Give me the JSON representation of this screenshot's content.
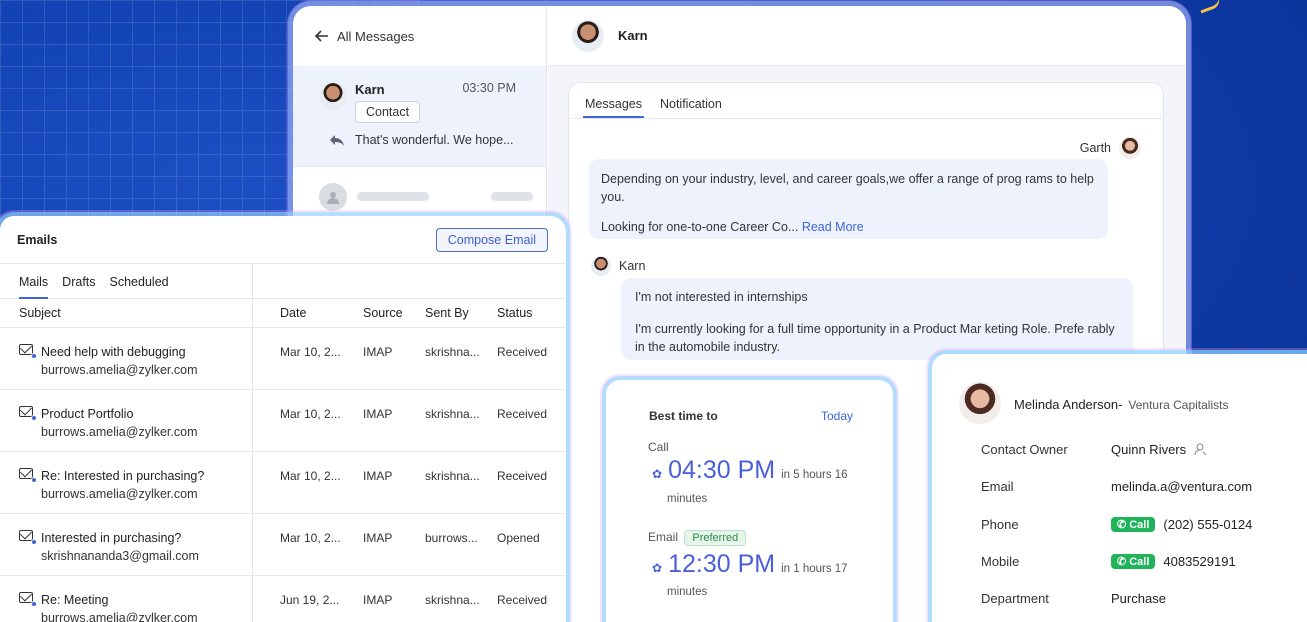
{
  "nav": {
    "back_label": "All Messages"
  },
  "inbox": {
    "item": {
      "name": "Karn",
      "time": "03:30 PM",
      "tag": "Contact",
      "preview": "That's wonderful. We hope..."
    }
  },
  "chat": {
    "contact_name": "Karn",
    "tabs": [
      "Messages",
      "Notification"
    ],
    "msg1": {
      "sender": "Garth",
      "line1": "Depending on  your industry, level, and career goals,we offer a  range of prog rams to help  you.",
      "line2": "Looking for one-to-one Career Co...",
      "read_more": "Read More"
    },
    "msg2": {
      "sender": "Karn",
      "line1": "I'm not interested in internships",
      "line2": "I'm currently looking for a full time opportunity in a Product Mar  keting Role. Prefe rably",
      "line3": "in the automobile industry."
    }
  },
  "emails": {
    "title": "Emails",
    "compose_label": "Compose Email",
    "tabs": [
      "Mails",
      "Drafts",
      "Scheduled"
    ],
    "columns": [
      "Subject",
      "Date",
      "Source",
      "Sent By",
      "Status"
    ],
    "rows": [
      {
        "subject": "Need help with debugging",
        "address": "burrows.amelia@zylker.com",
        "date": "Mar 10, 2...",
        "source": "IMAP",
        "sent_by": "skrishna...",
        "status": "Received"
      },
      {
        "subject": "Product Portfolio",
        "address": "burrows.amelia@zylker.com",
        "date": "Mar 10, 2...",
        "source": "IMAP",
        "sent_by": "skrishna...",
        "status": "Received"
      },
      {
        "subject": "Re: Interested in purchasing?",
        "address": "burrows.amelia@zylker.com",
        "date": "Mar 10, 2...",
        "source": "IMAP",
        "sent_by": "skrishna...",
        "status": "Received"
      },
      {
        "subject": "Interested in purchasing?",
        "address": "skrishnananda3@gmail.com",
        "date": "Mar 10, 2...",
        "source": "IMAP",
        "sent_by": "burrows...",
        "status": "Opened"
      },
      {
        "subject": "Re: Meeting",
        "address": "burrows.amelia@zylker.com",
        "date": "Jun 19, 2...",
        "source": "IMAP",
        "sent_by": "skrishna...",
        "status": "Received"
      }
    ]
  },
  "best_time": {
    "heading": "Best time to",
    "today": "Today",
    "call": {
      "label": "Call",
      "time": "04:30 PM",
      "rel": "in 5 hours 16",
      "min": "minutes"
    },
    "email": {
      "label": "Email",
      "badge": "Preferred",
      "time": "12:30 PM",
      "rel": "in 1 hours 17",
      "min": "minutes"
    }
  },
  "contact": {
    "name": "Melinda Anderson-",
    "company": "Ventura Capitalists",
    "call_label": "Call",
    "fields": [
      {
        "key": "Contact Owner",
        "value": "Quinn Rivers"
      },
      {
        "key": "Email",
        "value": "melinda.a@ventura.com"
      },
      {
        "key": "Phone",
        "value": "(202) 555-0124"
      },
      {
        "key": "Mobile",
        "value": "4083529191"
      },
      {
        "key": "Department",
        "value": "Purchase"
      }
    ]
  },
  "colors": {
    "accent": "#3d66d8",
    "bg": "#1040b0",
    "call_green": "#1fb35a"
  }
}
